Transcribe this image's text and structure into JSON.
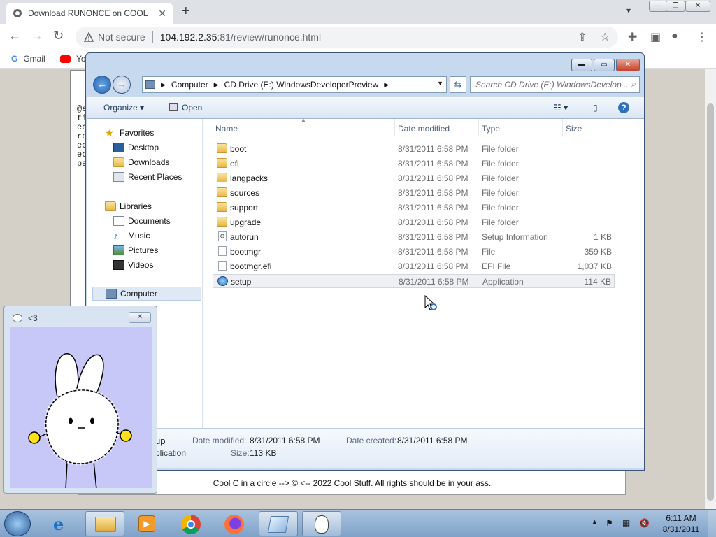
{
  "browser": {
    "tab_title": "Download RUNONCE on COOL S",
    "tab_close": "✕",
    "newtab": "+",
    "address_security": "Not secure",
    "url_host": "104.192.2.35",
    "url_rest": ":81/review/runonce.html",
    "bookmarks": [
      "Gmail",
      "Yo"
    ]
  },
  "explorer": {
    "breadcrumbs": [
      "Computer",
      "CD Drive (E:) WindowsDeveloperPreview"
    ],
    "search_placeholder": "Search CD Drive (E:) WindowsDevelop...",
    "organize_label": "Organize",
    "open_label": "Open",
    "favorites": {
      "title": "Favorites",
      "items": [
        "Desktop",
        "Downloads",
        "Recent Places"
      ]
    },
    "libraries": {
      "title": "Libraries",
      "items": [
        "Documents",
        "Music",
        "Pictures",
        "Videos"
      ]
    },
    "computer_label": "Computer",
    "columns": [
      "Name",
      "Date modified",
      "Type",
      "Size"
    ],
    "files": [
      {
        "name": "boot",
        "date": "8/31/2011 6:58 PM",
        "type": "File folder",
        "size": "",
        "icon": "folder"
      },
      {
        "name": "efi",
        "date": "8/31/2011 6:58 PM",
        "type": "File folder",
        "size": "",
        "icon": "folder"
      },
      {
        "name": "langpacks",
        "date": "8/31/2011 6:58 PM",
        "type": "File folder",
        "size": "",
        "icon": "folder"
      },
      {
        "name": "sources",
        "date": "8/31/2011 6:58 PM",
        "type": "File folder",
        "size": "",
        "icon": "folder"
      },
      {
        "name": "support",
        "date": "8/31/2011 6:58 PM",
        "type": "File folder",
        "size": "",
        "icon": "folder"
      },
      {
        "name": "upgrade",
        "date": "8/31/2011 6:58 PM",
        "type": "File folder",
        "size": "",
        "icon": "folder"
      },
      {
        "name": "autorun",
        "date": "8/31/2011 6:58 PM",
        "type": "Setup Information",
        "size": "1 KB",
        "icon": "settings"
      },
      {
        "name": "bootmgr",
        "date": "8/31/2011 6:58 PM",
        "type": "File",
        "size": "359 KB",
        "icon": "file"
      },
      {
        "name": "bootmgr.efi",
        "date": "8/31/2011 6:58 PM",
        "type": "EFI File",
        "size": "1,037 KB",
        "icon": "file"
      },
      {
        "name": "setup",
        "date": "8/31/2011 6:58 PM",
        "type": "Application",
        "size": "114 KB",
        "icon": "app",
        "selected": true
      }
    ],
    "details": {
      "name_fragment": "up",
      "type_fragment": "plication",
      "date_modified_label": "Date modified:",
      "date_modified": "8/31/2011 6:58 PM",
      "date_created_label": "Date created:",
      "date_created": "8/31/2011 6:58 PM",
      "size_label": "Size:",
      "size": "113 KB"
    }
  },
  "widget": {
    "title": "<3"
  },
  "page": {
    "footer": "Cool C in a circle --> © <-- 2022 Cool Stuff. All rights should be in your ass.",
    "bg_text": "@e\nti\nec\nro\nec\nec\npa"
  },
  "taskbar": {
    "time": "6:11 AM",
    "date": "8/31/2011"
  },
  "colors": {
    "explorer_frame": "#c7d9ee",
    "widget_bg": "#c8c8f8",
    "taskbar": "#8fb0d4"
  }
}
